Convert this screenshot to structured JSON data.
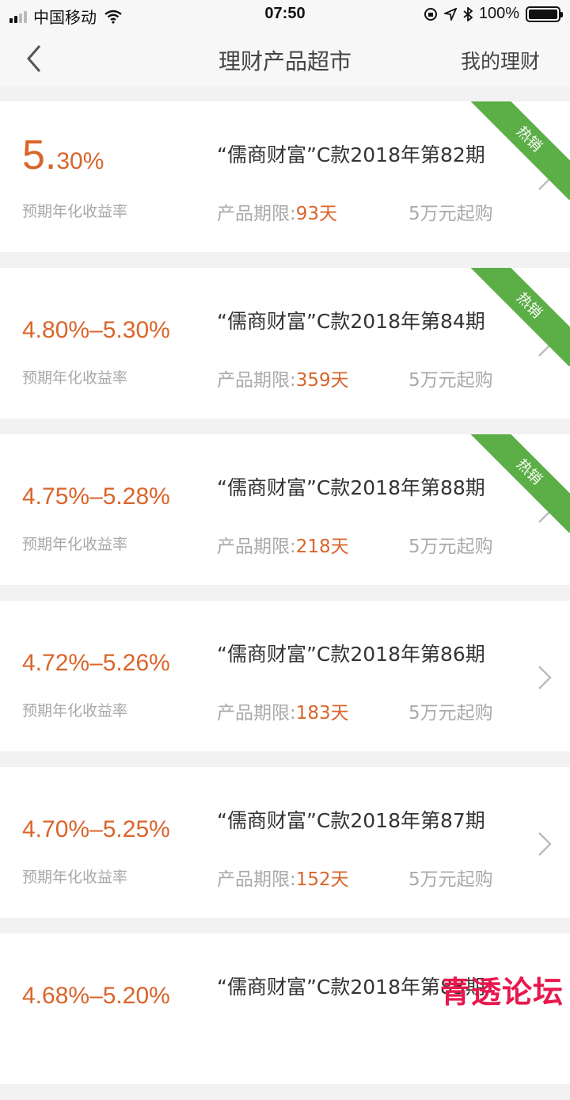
{
  "status_bar": {
    "carrier": "中国移动",
    "time": "07:50",
    "battery": "100%",
    "battery_level": 1.0
  },
  "nav": {
    "title": "理财产品超市",
    "right_label": "我的理财"
  },
  "products": [
    {
      "rate": "5.30%",
      "rate_int": "5.",
      "rate_dec": "30%",
      "rate_label": "预期年化收益率",
      "name": "“儒商财富”C款2018年第82期",
      "term_label": "产品期限:",
      "term_value": "93天",
      "min_buy": "5万元起购",
      "badge": "热销"
    },
    {
      "rate": "4.80%–5.30%",
      "rate_label": "预期年化收益率",
      "name": "“儒商财富”C款2018年第84期",
      "term_label": "产品期限:",
      "term_value": "359天",
      "min_buy": "5万元起购",
      "badge": "热销"
    },
    {
      "rate": "4.75%–5.28%",
      "rate_label": "预期年化收益率",
      "name": "“儒商财富”C款2018年第88期",
      "term_label": "产品期限:",
      "term_value": "218天",
      "min_buy": "5万元起购",
      "badge": "热销"
    },
    {
      "rate": "4.72%–5.26%",
      "rate_label": "预期年化收益率",
      "name": "“儒商财富”C款2018年第86期",
      "term_label": "产品期限:",
      "term_value": "183天",
      "min_buy": "5万元起购",
      "badge": ""
    },
    {
      "rate": "4.70%–5.25%",
      "rate_label": "预期年化收益率",
      "name": "“儒商财富”C款2018年第87期",
      "term_label": "产品期限:",
      "term_value": "152天",
      "min_buy": "5万元起购",
      "badge": ""
    },
    {
      "rate": "4.68%–5.20%",
      "rate_label": "",
      "name": "“儒商财富”C款2018年第83期",
      "term_label": "",
      "term_value": "",
      "min_buy": "",
      "badge": ""
    }
  ],
  "watermark": "青透论坛",
  "colors": {
    "accent": "#d9652a",
    "badge": "#5cae47",
    "watermark": "#e8174d"
  }
}
